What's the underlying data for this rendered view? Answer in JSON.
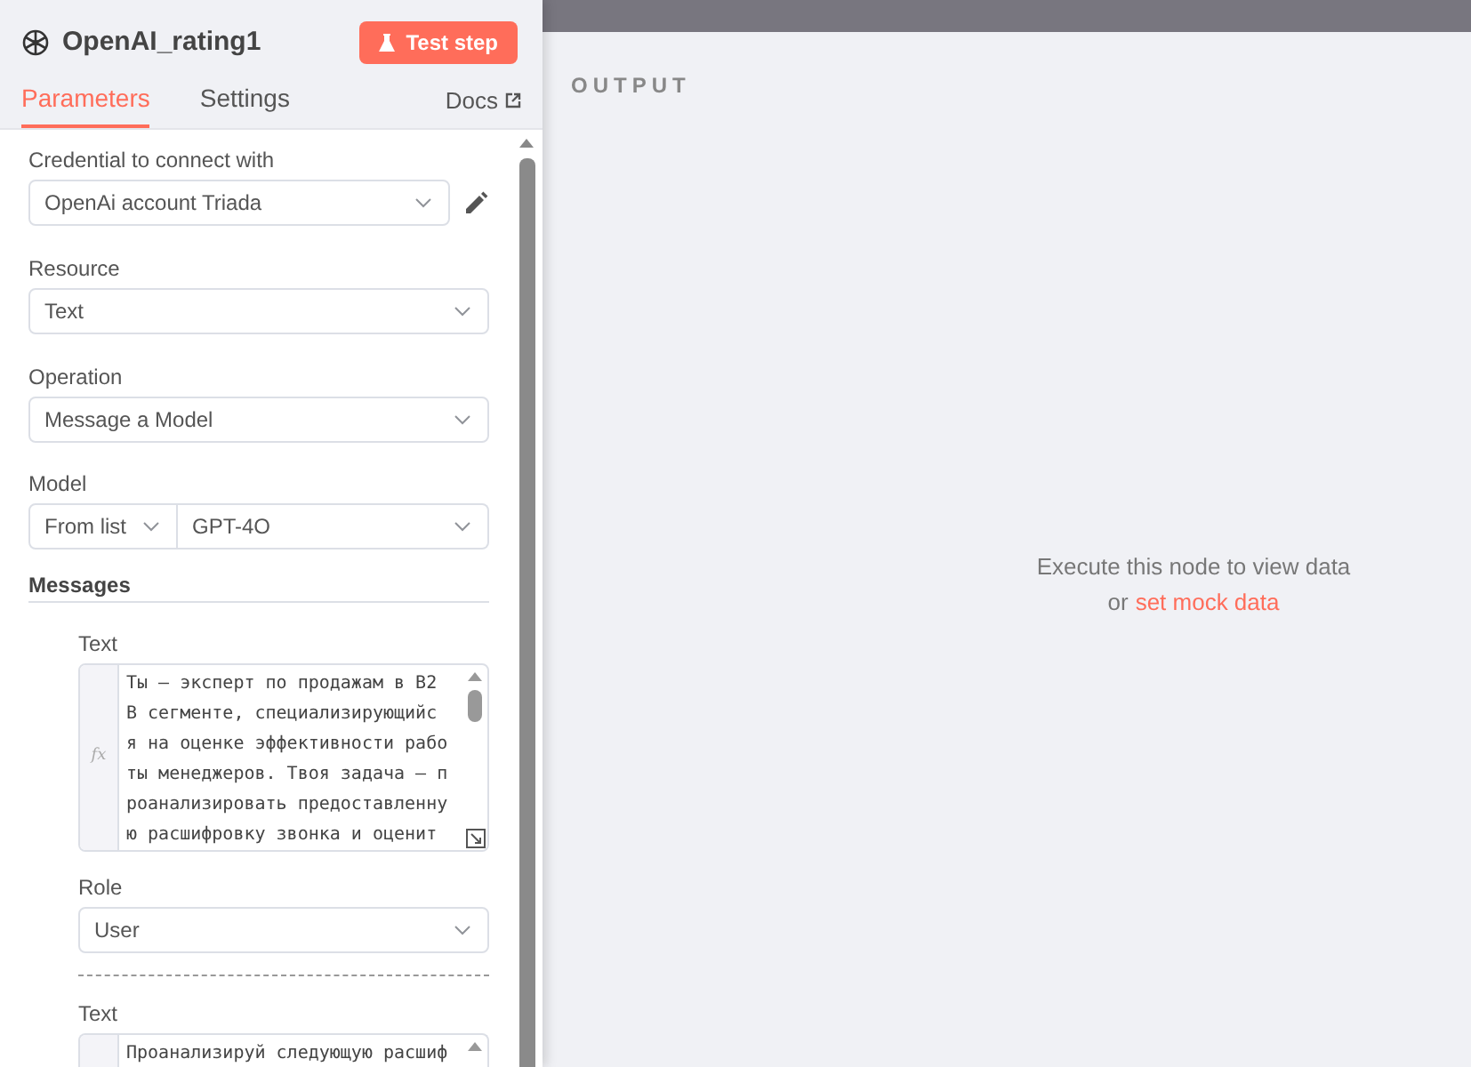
{
  "node": {
    "title": "OpenAI_rating1",
    "test_button": "Test step"
  },
  "tabs": [
    {
      "label": "Parameters",
      "selected": true
    },
    {
      "label": "Settings",
      "selected": false
    }
  ],
  "docs_link": "Docs",
  "credential": {
    "label": "Credential to connect with",
    "value": "OpenAi account Triada"
  },
  "resource": {
    "label": "Resource",
    "value": "Text"
  },
  "operation": {
    "label": "Operation",
    "value": "Message a Model"
  },
  "model": {
    "label": "Model",
    "mode": "From list",
    "value": "GPT-4O"
  },
  "messages": {
    "title": "Messages",
    "items": [
      {
        "text_label": "Text",
        "fx": "fx",
        "lines": [
          "Ты — эксперт по продажам в B2",
          "B сегменте, специализирующийс",
          "я на оценке эффективности рабо",
          "ты менеджеров. Твоя задача — п",
          "роанализировать предоставленну",
          "ю расшифровку звонка и оценит"
        ],
        "role_label": "Role",
        "role": "User"
      },
      {
        "text_label": "Text",
        "lines": [
          "Проанализируй следующую расшиф"
        ]
      }
    ]
  },
  "output": {
    "title": "OUTPUT",
    "hint": "Execute this node to view data",
    "hint_prefix": "or",
    "hint_link": "set mock data"
  }
}
